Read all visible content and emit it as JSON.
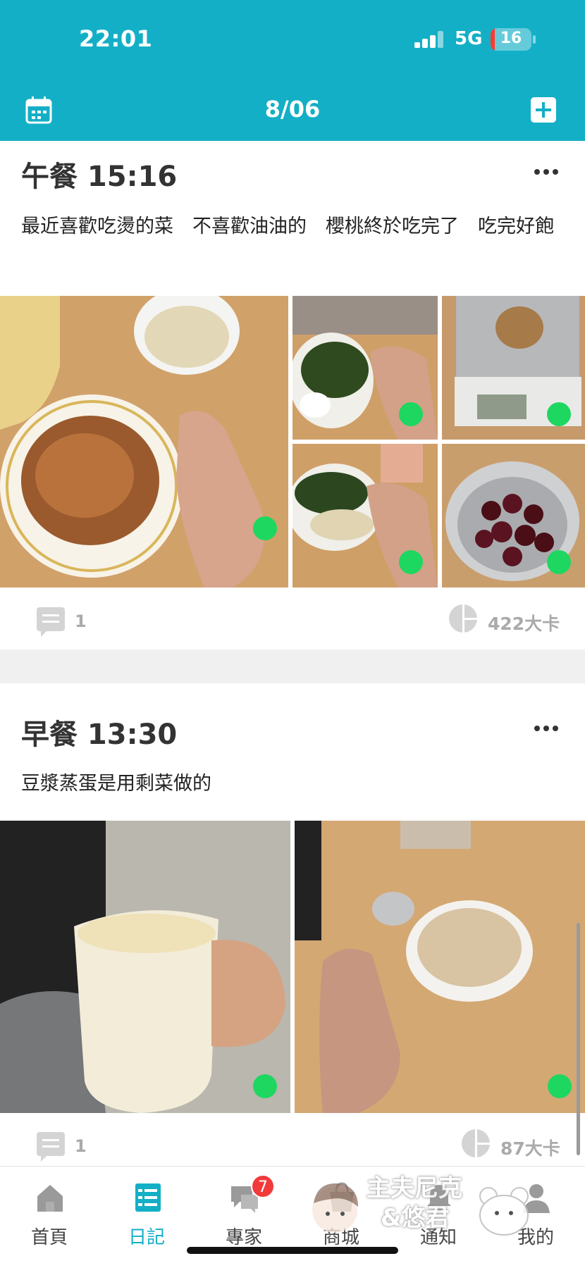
{
  "status_bar": {
    "time": "22:01",
    "network": "5G",
    "battery": "16"
  },
  "header": {
    "date": "8/06"
  },
  "meals": [
    {
      "title": "午餐 15:16",
      "note": "最近喜歡吃燙的菜　不喜歡油油的　櫻桃終於吃完了　吃完好飽",
      "comments": "1",
      "calories": "422大卡"
    },
    {
      "title": "早餐 13:30",
      "note": "豆漿蒸蛋是用剩菜做的",
      "comments": "1",
      "calories": "87大卡"
    }
  ],
  "bottom_nav": {
    "items": [
      {
        "label": "首頁"
      },
      {
        "label": "日記"
      },
      {
        "label": "專家"
      },
      {
        "label": "商城"
      },
      {
        "label": "通知"
      },
      {
        "label": "我的"
      }
    ],
    "expert_badge": "7"
  },
  "watermark": {
    "line1": "主夫尼克",
    "line2": "&悠君"
  },
  "colors": {
    "primary": "#13afc6",
    "status_dot": "#1ed760",
    "badge": "#f23a3a"
  }
}
